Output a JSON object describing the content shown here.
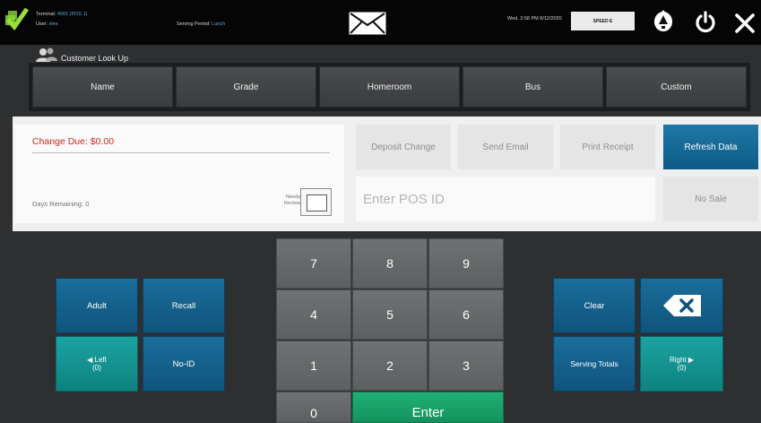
{
  "header": {
    "terminal_label": "Terminal:",
    "terminal_value": "4001 (POS 1)",
    "user_label": "User:",
    "user_value": "slee",
    "serving_period_label": "Serving Period:",
    "serving_period_value": "Lunch",
    "datetime": "Wed, 3:58 PM 8/12/2020",
    "speed_label": "SPEED E"
  },
  "lookup": {
    "title": "Customer Look Up",
    "tabs": [
      "Name",
      "Grade",
      "Homeroom",
      "Bus",
      "Custom"
    ]
  },
  "customer": {
    "change_due": "Change Due: $0.00",
    "days_remaining": "Days Remaining: 0",
    "needs_review_label": "Needs Review"
  },
  "actions": {
    "deposit_change": "Deposit Change",
    "send_email": "Send Email",
    "print_receipt": "Print Receipt",
    "refresh_data": "Refresh Data",
    "no_sale": "No Sale"
  },
  "pos_input": {
    "placeholder": "Enter POS ID"
  },
  "keypad": {
    "keys": [
      "7",
      "8",
      "9",
      "4",
      "5",
      "6",
      "1",
      "2",
      "3",
      "0"
    ],
    "enter": "Enter"
  },
  "left_buttons": {
    "adult": "Adult",
    "recall": "Recall",
    "left": "◀ Left",
    "left_count": "(0)",
    "no_id": "No-ID"
  },
  "right_buttons": {
    "clear": "Clear",
    "serving_totals": "Serving Totals",
    "right": "Right ▶",
    "right_count": "(0)"
  },
  "colors": {
    "accent_blue": "#0f547d",
    "accent_teal": "#0e8280",
    "enter_green": "#14925e",
    "change_due_red": "#d0281e"
  }
}
